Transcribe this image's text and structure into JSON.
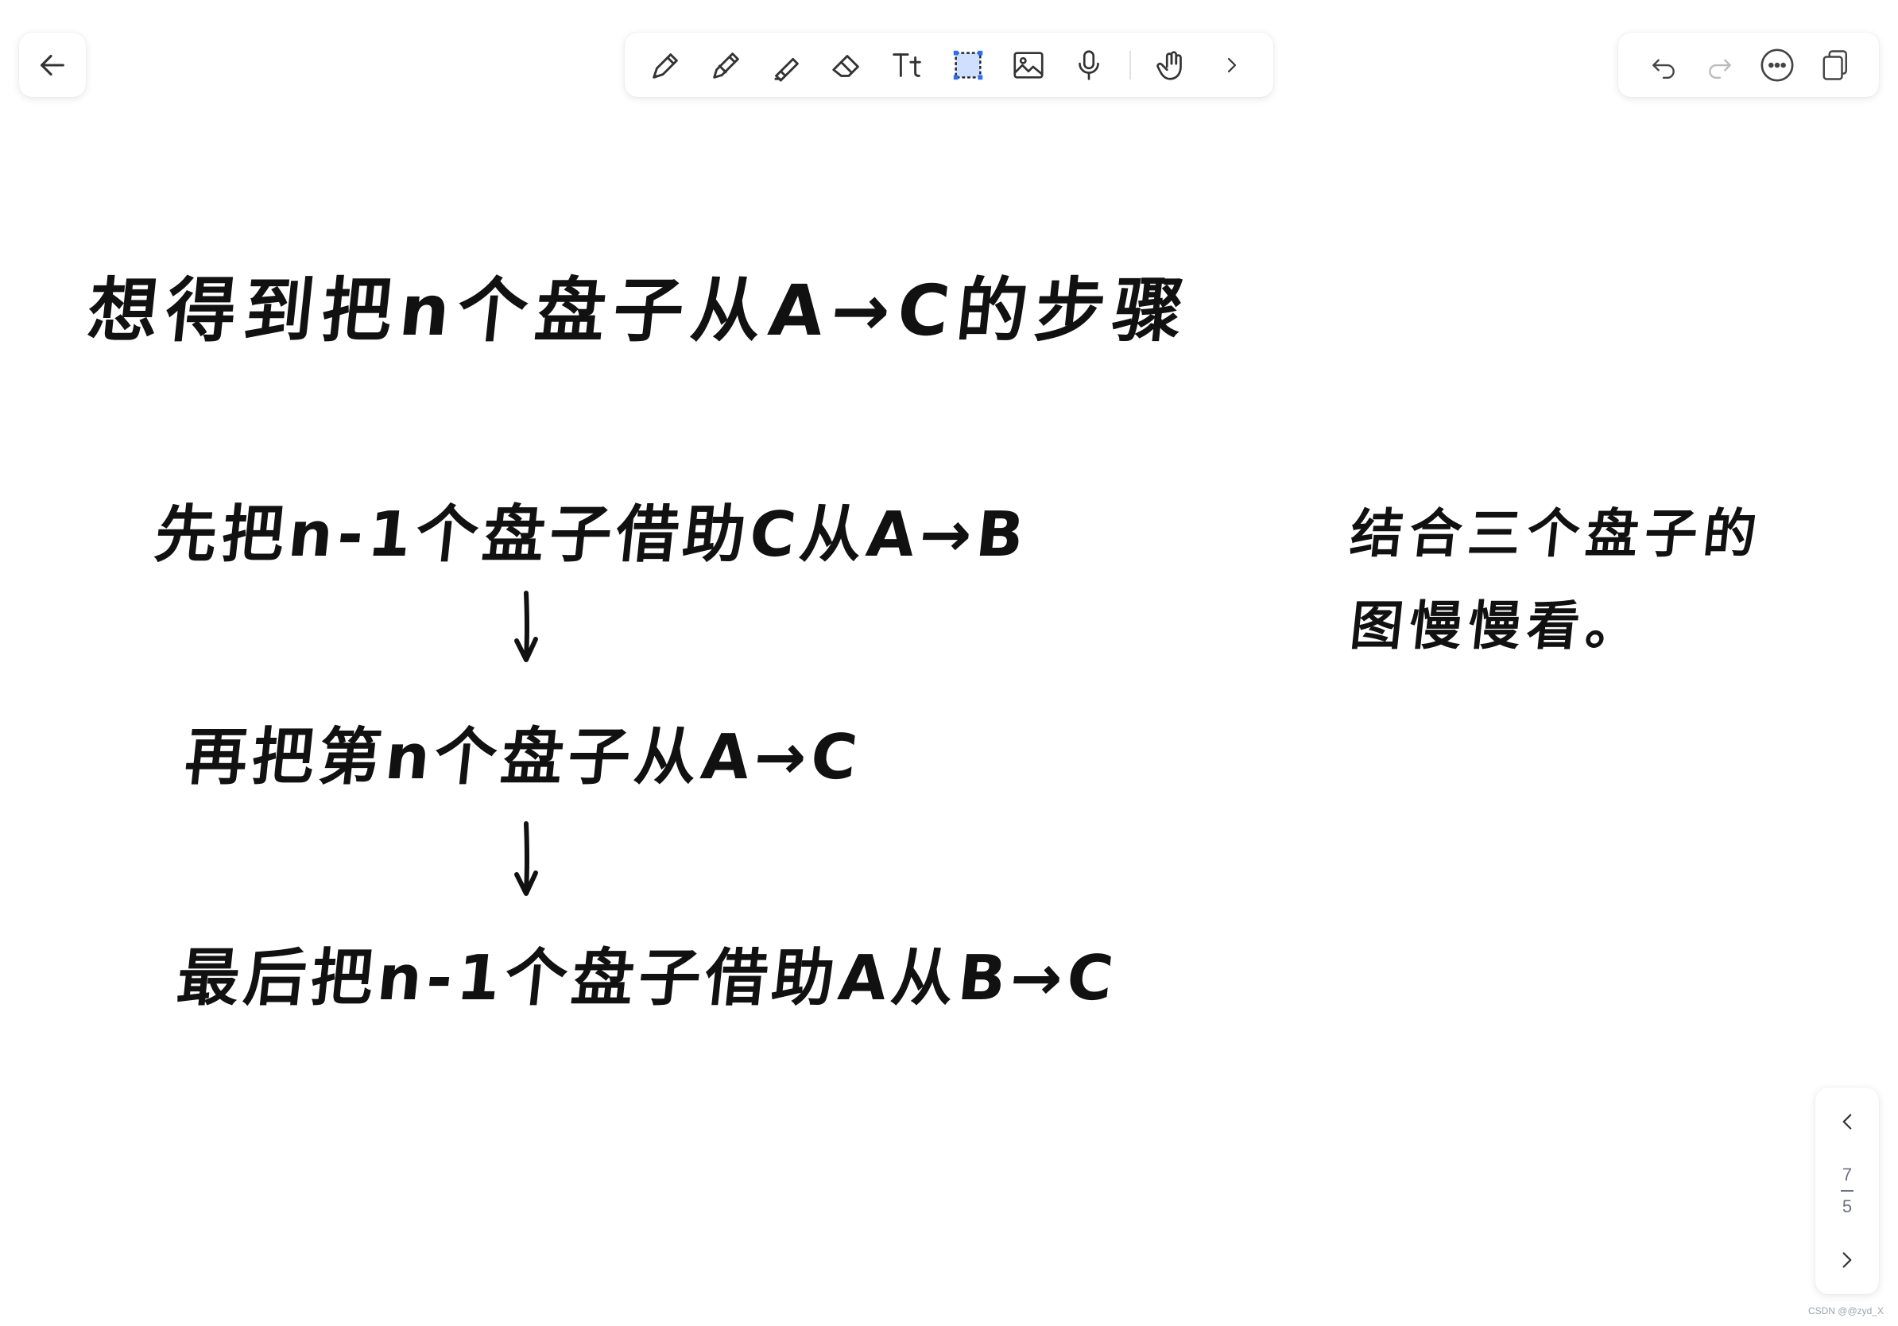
{
  "toolbar": {
    "tools": [
      "pen-icon",
      "pencil-icon",
      "highlighter-icon",
      "eraser-icon",
      "text-icon",
      "lasso-select-icon",
      "image-icon",
      "microphone-icon",
      "hand-touch-icon",
      "chevron-right-icon"
    ],
    "selected_tool": "lasso-select-icon",
    "accent_color": "#2f6fed"
  },
  "actions": [
    "undo-icon",
    "redo-icon",
    "more-icon",
    "pages-icon"
  ],
  "pager": {
    "current": "7",
    "total": "5"
  },
  "canvas": {
    "title": "想得到把n个盘子从A→C的步骤",
    "step1": "先把n-1个盘子借助C从A→B",
    "step2": "再把第n个盘子从A→C",
    "step3": "最后把n-1个盘子借助A从B→C",
    "note_line1": "结合三个盘子的",
    "note_line2": "图慢慢看。"
  },
  "watermark": "CSDN @@zyd_X"
}
